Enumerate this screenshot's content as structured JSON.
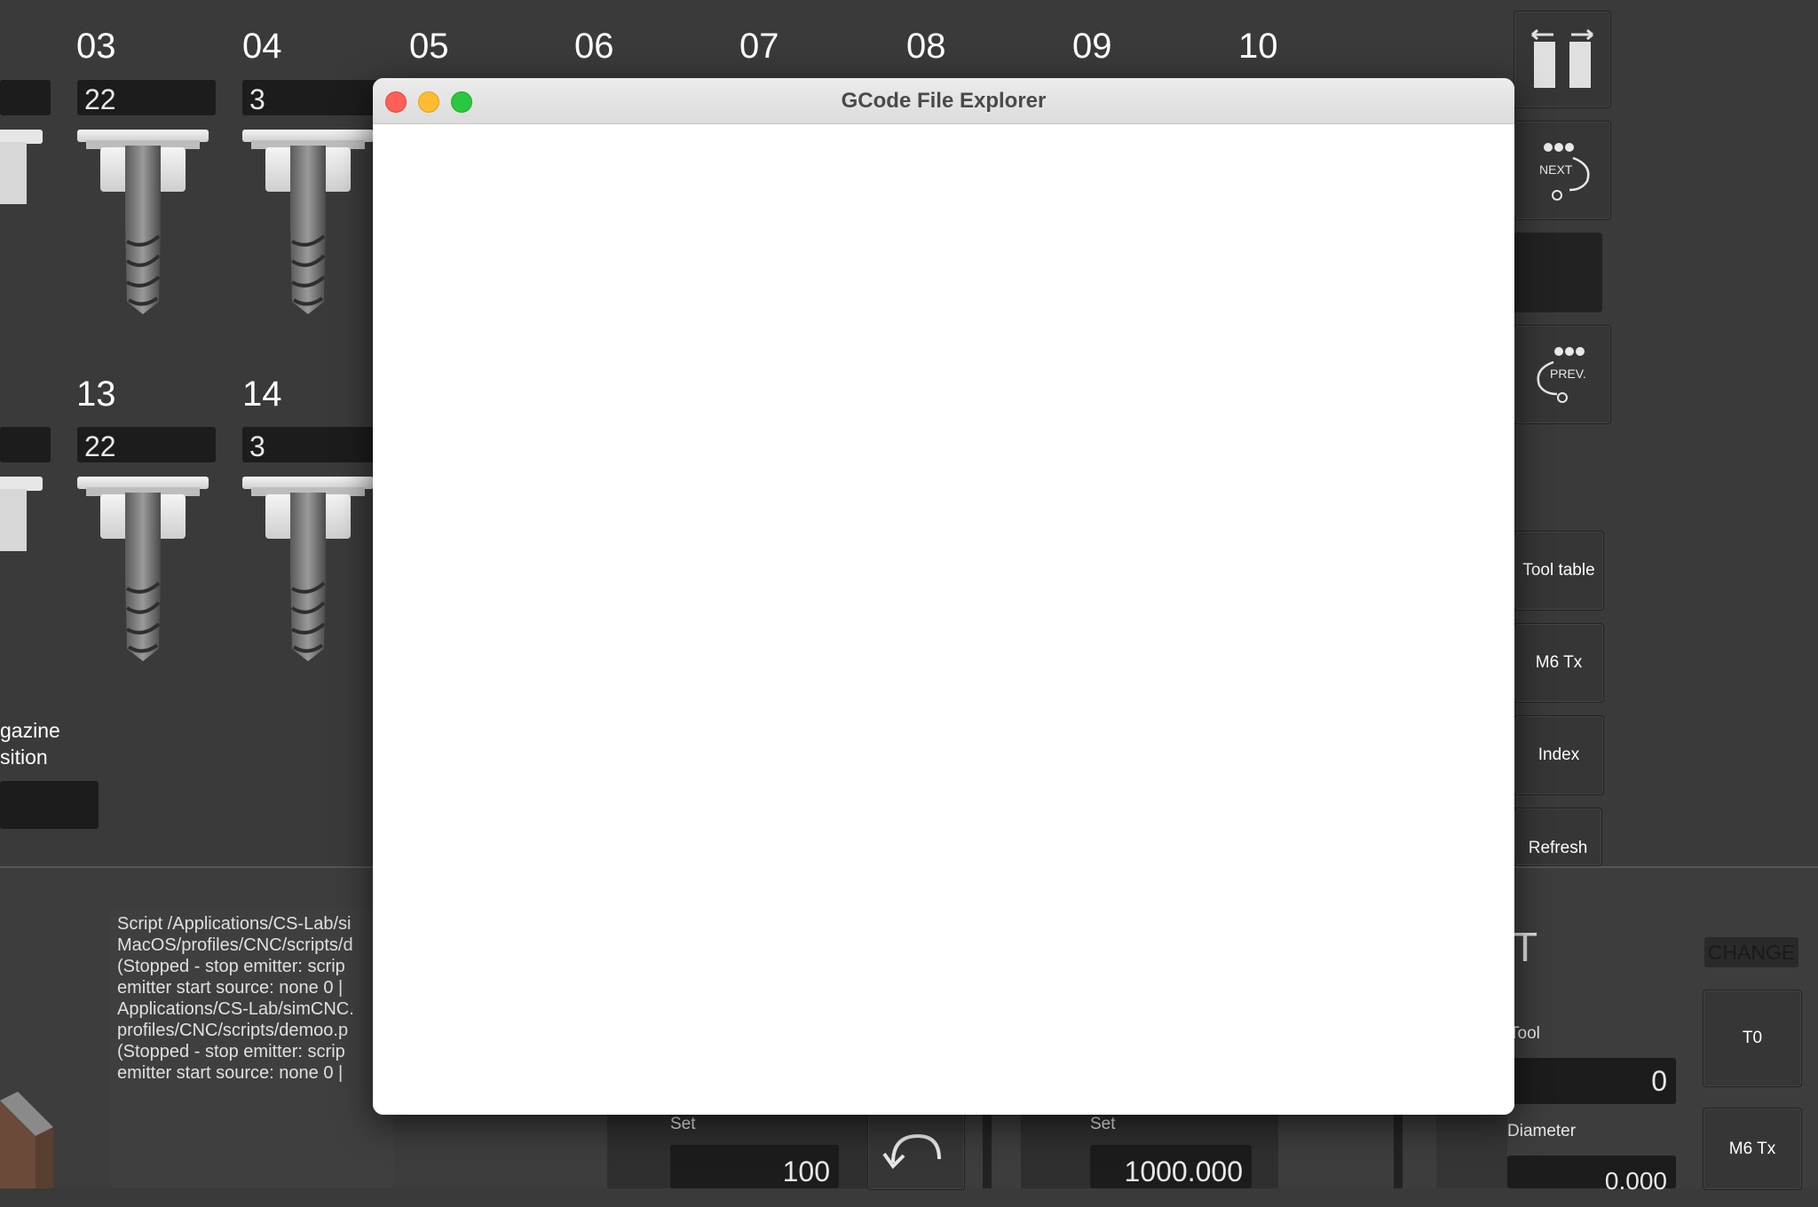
{
  "background_app": {
    "columns_top": [
      "03",
      "04",
      "05",
      "06",
      "07",
      "08",
      "09",
      "10"
    ],
    "columns_bottom": [
      "13",
      "14"
    ],
    "slot_values_top": [
      "22",
      "3"
    ],
    "slot_values_bottom": [
      "22",
      "3"
    ],
    "magazine_label_line1": "gazine",
    "magazine_label_line2": "sition",
    "side_buttons": {
      "next_label": "NEXT",
      "prev_label": "PREV.",
      "tool_table": "Tool table",
      "m6tx": "M6 Tx",
      "index": "Index",
      "refresh": "Refresh"
    },
    "console_lines": [
      "Script /Applications/CS-Lab/si",
      "MacOS/profiles/CNC/scripts/d",
      "(Stopped - stop emitter: scrip",
      "emitter start source: none 0 |",
      "Applications/CS-Lab/simCNC.",
      "profiles/CNC/scripts/demoo.p",
      "(Stopped - stop emitter: scrip",
      "emitter start source: none 0 |"
    ],
    "set_label_1": "Set",
    "set_value_1": "100",
    "set_label_2": "Set",
    "set_value_2": "1000.000",
    "tool_panel": {
      "heading_fragment": "T",
      "change_label": "CHANGE",
      "tool_label": "Tool",
      "tool_value": "0",
      "diameter_label": "Diameter",
      "diameter_value": "0.000",
      "t0_button": "T0",
      "m6tx_button": "M6 Tx"
    }
  },
  "modal": {
    "title": "GCode File Explorer"
  },
  "colors": {
    "background": "#3a3a3a",
    "close": "#fe5f57",
    "minimize": "#febc2e",
    "zoom": "#28c840"
  }
}
